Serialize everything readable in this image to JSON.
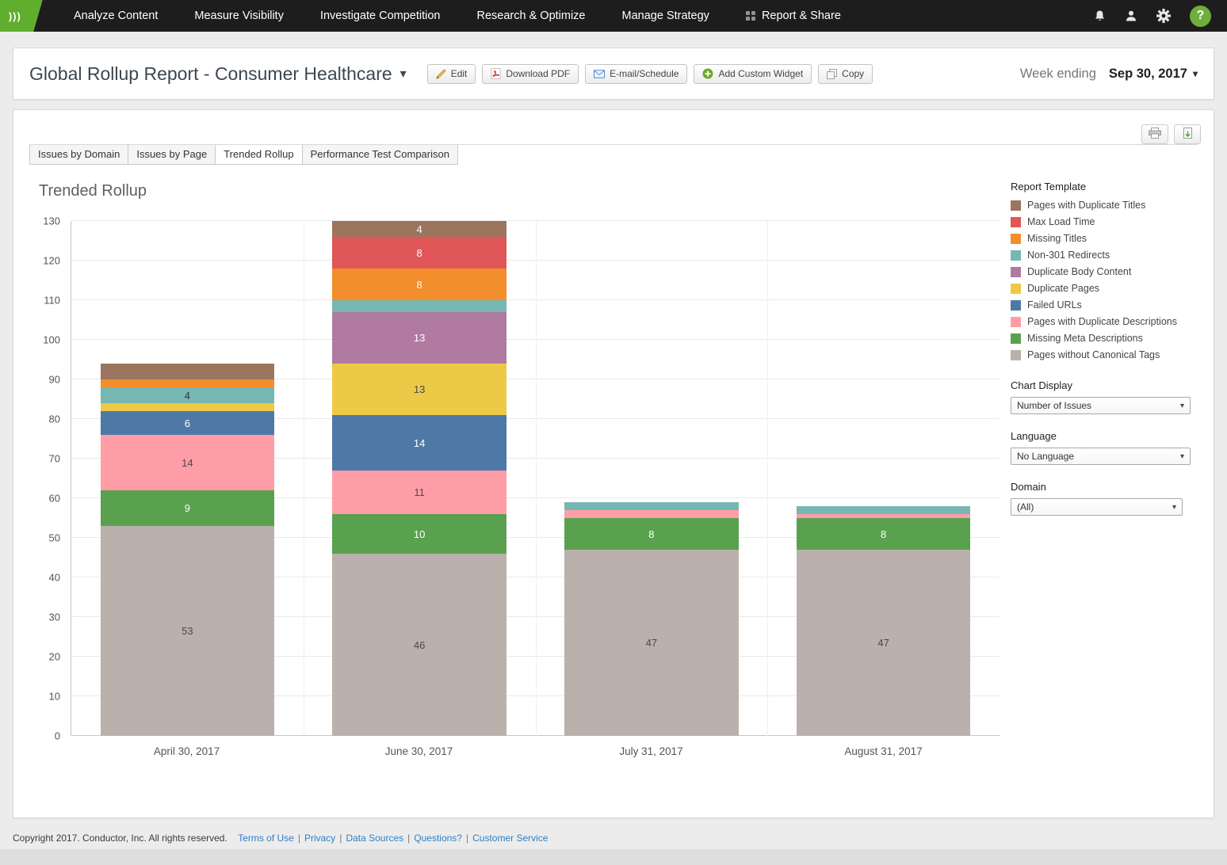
{
  "nav": {
    "logo": "Conductor",
    "items": [
      {
        "label": "Analyze Content",
        "icon": ""
      },
      {
        "label": "Measure Visibility",
        "icon": ""
      },
      {
        "label": "Investigate Competition",
        "icon": ""
      },
      {
        "label": "Research & Optimize",
        "icon": ""
      },
      {
        "label": "Manage Strategy",
        "icon": ""
      },
      {
        "label": "Report & Share",
        "icon": "grid-dots"
      }
    ]
  },
  "icons": {
    "caret_down": "▾",
    "help": "?",
    "logo_mark": ")))"
  },
  "header": {
    "title": "Global Rollup Report - Consumer Healthcare",
    "buttons": [
      {
        "label": "Edit",
        "icon": "pencil"
      },
      {
        "label": "Download PDF",
        "icon": "pdf"
      },
      {
        "label": "E-mail/Schedule",
        "icon": "envelope"
      },
      {
        "label": "Add Custom Widget",
        "icon": "plus"
      },
      {
        "label": "Copy",
        "icon": "copy"
      }
    ],
    "week_ending_label": "Week ending",
    "week_ending_value": "Sep 30, 2017"
  },
  "tabs": {
    "items": [
      "Issues by Domain",
      "Issues by Page",
      "Trended Rollup",
      "Performance Test Comparison"
    ],
    "active": "Trended Rollup"
  },
  "chart_data": {
    "type": "bar",
    "stacked": true,
    "title": "Trended Rollup",
    "categories": [
      "April 30, 2017",
      "June 30, 2017",
      "July 31, 2017",
      "August 31, 2017"
    ],
    "ylim": [
      0,
      130
    ],
    "ytick_step": 10,
    "grid": "horizontal",
    "legend_position": "right",
    "series": [
      {
        "name": "Pages without Canonical Tags",
        "color": "#bab0ac",
        "label_color": "#4a4a4a",
        "values": [
          53,
          46,
          47,
          47
        ],
        "labels": [
          "53",
          "46",
          "47",
          "47"
        ]
      },
      {
        "name": "Missing Meta Descriptions",
        "color": "#59a14f",
        "label_color": "#ffffff",
        "values": [
          9,
          10,
          8,
          8
        ],
        "labels": [
          "9",
          "10",
          "8",
          "8"
        ]
      },
      {
        "name": "Pages with Duplicate Descriptions",
        "color": "#ff9da7",
        "label_color": "#4a4a4a",
        "values": [
          14,
          11,
          2,
          1
        ],
        "labels": [
          "14",
          "11",
          "",
          ""
        ]
      },
      {
        "name": "Failed URLs",
        "color": "#4e79a7",
        "label_color": "#ffffff",
        "values": [
          6,
          14,
          0,
          0
        ],
        "labels": [
          "6",
          "14",
          "",
          ""
        ]
      },
      {
        "name": "Duplicate Pages",
        "color": "#edc948",
        "label_color": "#4a4a4a",
        "values": [
          2,
          13,
          0,
          0
        ],
        "labels": [
          "",
          "13",
          "",
          ""
        ]
      },
      {
        "name": "Duplicate Body Content",
        "color": "#b07aa1",
        "label_color": "#ffffff",
        "values": [
          0,
          13,
          0,
          0
        ],
        "labels": [
          "",
          "13",
          "",
          ""
        ]
      },
      {
        "name": "Non-301 Redirects",
        "color": "#76b7b2",
        "label_color": "#333333",
        "values": [
          4,
          3,
          2,
          2
        ],
        "labels": [
          "4",
          "",
          "",
          ""
        ]
      },
      {
        "name": "Missing Titles",
        "color": "#f28e2b",
        "label_color": "#ffffff",
        "values": [
          2,
          8,
          0,
          0
        ],
        "labels": [
          "",
          "8",
          "",
          ""
        ]
      },
      {
        "name": "Max Load Time",
        "color": "#e15759",
        "label_color": "#ffffff",
        "values": [
          0,
          8,
          0,
          0
        ],
        "labels": [
          "",
          "8",
          "",
          ""
        ]
      },
      {
        "name": "Pages with Duplicate Titles",
        "color": "#9c755f",
        "label_color": "#ffffff",
        "values": [
          4,
          4,
          0,
          0
        ],
        "labels": [
          "",
          "4",
          "",
          ""
        ]
      }
    ]
  },
  "controls": {
    "legend_title": "Report Template",
    "chart_display": {
      "label": "Chart Display",
      "value": "Number of Issues"
    },
    "language": {
      "label": "Language",
      "value": "No Language"
    },
    "domain": {
      "label": "Domain",
      "value": "(All)"
    }
  },
  "footer": {
    "copyright": "Copyright 2017. Conductor, Inc. All rights reserved.",
    "links": [
      "Terms of Use",
      "Privacy",
      "Data Sources",
      "Questions?",
      "Customer Service"
    ]
  }
}
